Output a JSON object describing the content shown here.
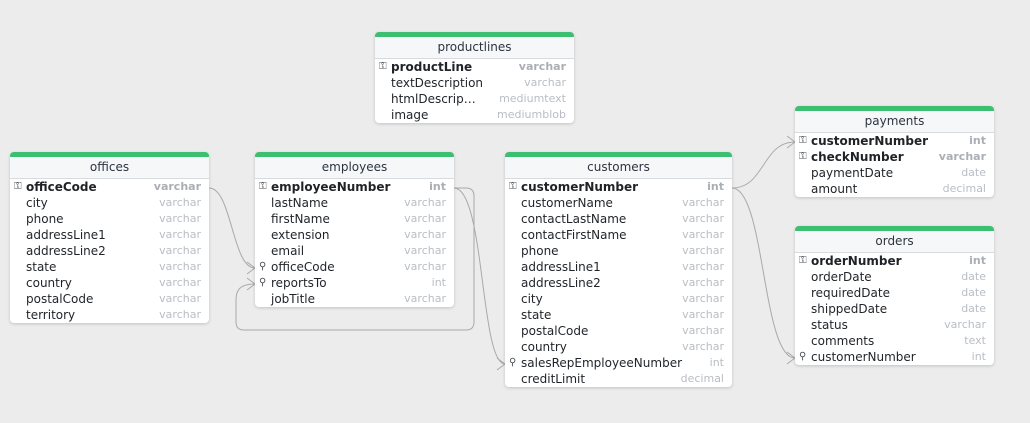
{
  "colors": {
    "header_bar": "#3dbf72",
    "link": "#a9a9a9",
    "background": "#ececec"
  },
  "tables": [
    {
      "name": "productlines",
      "fields": [
        {
          "name": "productLine",
          "type": "varchar",
          "pk": true,
          "icon": "key-icon"
        },
        {
          "name": "textDescription",
          "type": "varchar"
        },
        {
          "name": "htmlDescrip…",
          "type": "mediumtext"
        },
        {
          "name": "image",
          "type": "mediumblob"
        }
      ]
    },
    {
      "name": "offices",
      "fields": [
        {
          "name": "officeCode",
          "type": "varchar",
          "pk": true,
          "icon": "key-icon"
        },
        {
          "name": "city",
          "type": "varchar"
        },
        {
          "name": "phone",
          "type": "varchar"
        },
        {
          "name": "addressLine1",
          "type": "varchar"
        },
        {
          "name": "addressLine2",
          "type": "varchar"
        },
        {
          "name": "state",
          "type": "varchar"
        },
        {
          "name": "country",
          "type": "varchar"
        },
        {
          "name": "postalCode",
          "type": "varchar"
        },
        {
          "name": "territory",
          "type": "varchar"
        }
      ]
    },
    {
      "name": "employees",
      "fields": [
        {
          "name": "employeeNumber",
          "type": "int",
          "pk": true,
          "icon": "key-icon"
        },
        {
          "name": "lastName",
          "type": "varchar"
        },
        {
          "name": "firstName",
          "type": "varchar"
        },
        {
          "name": "extension",
          "type": "varchar"
        },
        {
          "name": "email",
          "type": "varchar"
        },
        {
          "name": "officeCode",
          "type": "varchar",
          "icon": "foreign-key-icon"
        },
        {
          "name": "reportsTo",
          "type": "int",
          "icon": "foreign-key-icon"
        },
        {
          "name": "jobTitle",
          "type": "varchar"
        }
      ]
    },
    {
      "name": "customers",
      "fields": [
        {
          "name": "customerNumber",
          "type": "int",
          "pk": true,
          "icon": "key-icon"
        },
        {
          "name": "customerName",
          "type": "varchar"
        },
        {
          "name": "contactLastName",
          "type": "varchar"
        },
        {
          "name": "contactFirstName",
          "type": "varchar"
        },
        {
          "name": "phone",
          "type": "varchar"
        },
        {
          "name": "addressLine1",
          "type": "varchar"
        },
        {
          "name": "addressLine2",
          "type": "varchar"
        },
        {
          "name": "city",
          "type": "varchar"
        },
        {
          "name": "state",
          "type": "varchar"
        },
        {
          "name": "postalCode",
          "type": "varchar"
        },
        {
          "name": "country",
          "type": "varchar"
        },
        {
          "name": "salesRepEmployeeNumber",
          "type": "int",
          "icon": "foreign-key-icon"
        },
        {
          "name": "creditLimit",
          "type": "decimal"
        }
      ]
    },
    {
      "name": "payments",
      "fields": [
        {
          "name": "customerNumber",
          "type": "int",
          "pk": true,
          "icon": "key-foreign-key-icon"
        },
        {
          "name": "checkNumber",
          "type": "varchar",
          "pk": true,
          "icon": "key-icon"
        },
        {
          "name": "paymentDate",
          "type": "date"
        },
        {
          "name": "amount",
          "type": "decimal"
        }
      ]
    },
    {
      "name": "orders",
      "fields": [
        {
          "name": "orderNumber",
          "type": "int",
          "pk": true,
          "icon": "key-icon"
        },
        {
          "name": "orderDate",
          "type": "date"
        },
        {
          "name": "requiredDate",
          "type": "date"
        },
        {
          "name": "shippedDate",
          "type": "date"
        },
        {
          "name": "status",
          "type": "varchar"
        },
        {
          "name": "comments",
          "type": "text"
        },
        {
          "name": "customerNumber",
          "type": "int",
          "icon": "foreign-key-icon"
        }
      ]
    }
  ],
  "relationships": [
    {
      "from": "employees.officeCode",
      "to": "offices.officeCode"
    },
    {
      "from": "employees.reportsTo",
      "to": "employees.employeeNumber"
    },
    {
      "from": "customers.salesRepEmployeeNumber",
      "to": "employees.employeeNumber"
    },
    {
      "from": "payments.customerNumber",
      "to": "customers.customerNumber"
    },
    {
      "from": "orders.customerNumber",
      "to": "customers.customerNumber"
    }
  ]
}
